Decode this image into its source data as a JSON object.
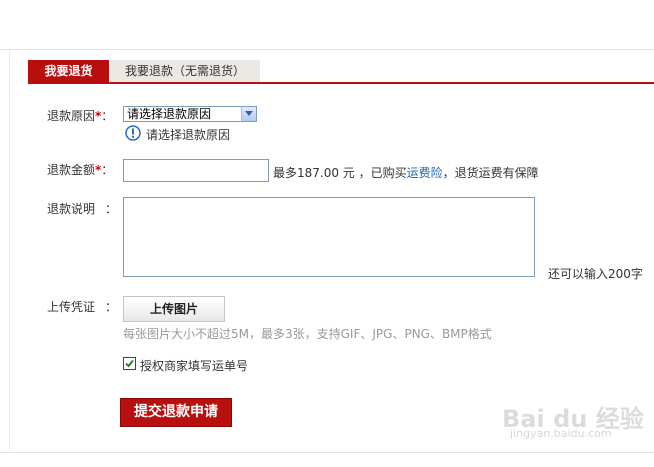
{
  "tabs": {
    "active": "我要退货",
    "inactive": "我要退款（无需退货）"
  },
  "reason": {
    "label": "退款原因",
    "required": "*",
    "colon": "：",
    "selected": "请选择退款原因",
    "hint": "请选择退款原因"
  },
  "amount": {
    "label": "退款金额",
    "required": "*",
    "colon": "：",
    "value": "",
    "note_prefix": "最多187.00 元 ，已购买",
    "note_link": "运费险",
    "note_suffix": "，退货运费有保障"
  },
  "description": {
    "label": "退款说明",
    "colon": "：",
    "value": "",
    "remaining": "还可以输入200字"
  },
  "upload": {
    "label": "上传凭证",
    "colon": "：",
    "button": "上传图片",
    "note": "每张图片大小不超过5M，最多3张，支持GIF、JPG、PNG、BMP格式"
  },
  "authorize": {
    "checked": true,
    "label": "授权商家填写运单号"
  },
  "submit": {
    "label": "提交退款申请"
  },
  "watermark": {
    "text": "Bai du 经验",
    "url": "jingyan.baidu.com"
  },
  "colors": {
    "accent_red": "#b90e0e",
    "tab_inactive_bg": "#ece9e4",
    "link_blue": "#1a66b3",
    "input_border": "#7f9db9",
    "muted_text": "#999999"
  },
  "icons": {
    "hint": "info-circle-icon",
    "select": "chevron-down-icon",
    "checkbox": "checkmark-icon"
  }
}
